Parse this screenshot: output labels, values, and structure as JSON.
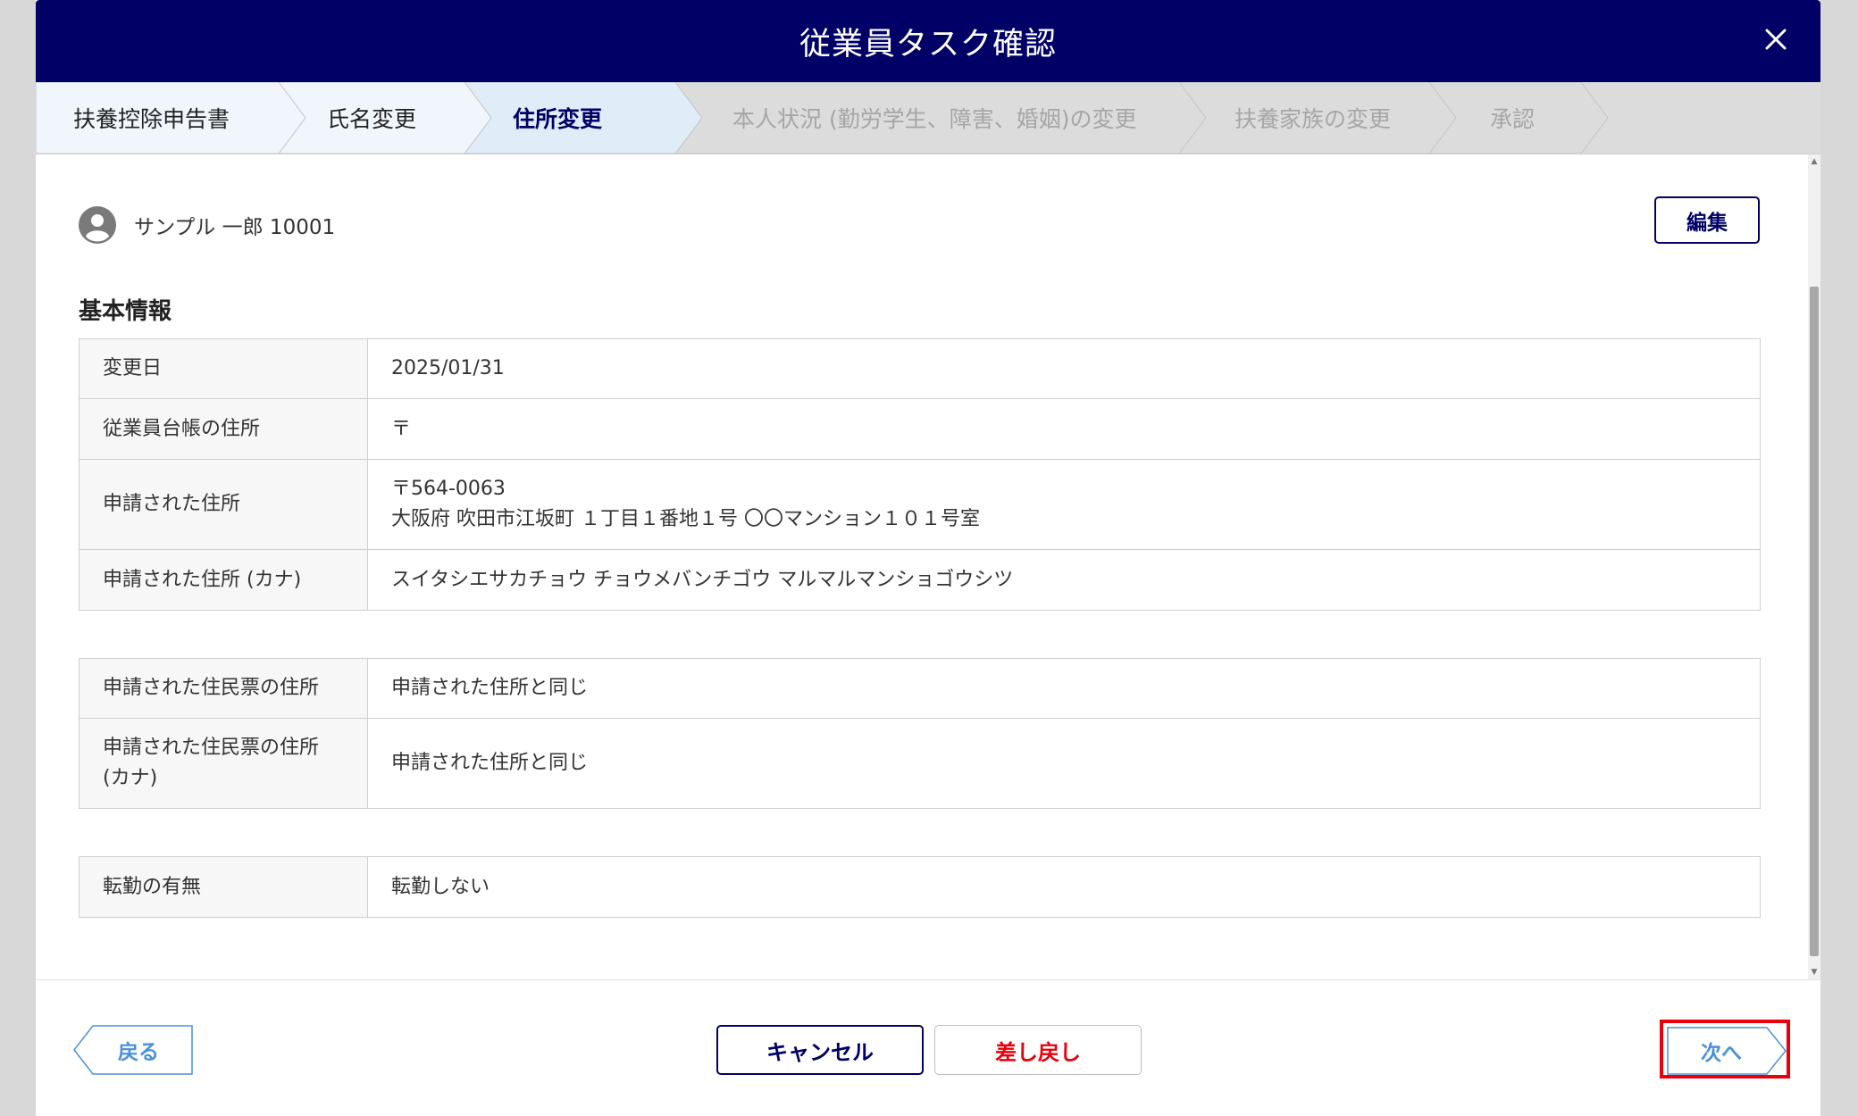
{
  "modal": {
    "title": "従業員タスク確認",
    "close_icon": "close-icon"
  },
  "steps": [
    {
      "label": "扶養控除申告書",
      "state": "done"
    },
    {
      "label": "氏名変更",
      "state": "done"
    },
    {
      "label": "住所変更",
      "state": "active"
    },
    {
      "label": "本人状況 (勤労学生、障害、婚姻)の変更",
      "state": "pending"
    },
    {
      "label": "扶養家族の変更",
      "state": "pending"
    },
    {
      "label": "承認",
      "state": "pending"
    }
  ],
  "employee": {
    "icon": "user-circle-icon",
    "name": "サンプル 一郎 10001"
  },
  "edit_label": "編集",
  "section_title": "基本情報",
  "table1": [
    {
      "key": "変更日",
      "value": "2025/01/31"
    },
    {
      "key": "従業員台帳の住所",
      "value": "〒"
    },
    {
      "key": "申請された住所",
      "value_line1": "〒564-0063",
      "value_line2": "大阪府 吹田市江坂町 １丁目１番地１号 〇〇マンション１０１号室"
    },
    {
      "key": "申請された住所 (カナ)",
      "value": "スイタシエサカチョウ チョウメバンチゴウ マルマルマンショゴウシツ"
    }
  ],
  "table2": [
    {
      "key": "申請された住民票の住所",
      "value": "申請された住所と同じ"
    },
    {
      "key_line1": "申請された住民票の住所",
      "key_line2": "(カナ)",
      "value": "申請された住所と同じ"
    }
  ],
  "table3": [
    {
      "key": "転勤の有無",
      "value": "転勤しない"
    }
  ],
  "footer": {
    "back_label": "戻る",
    "cancel_label": "キャンセル",
    "return_label": "差し戻し",
    "next_label": "次へ"
  },
  "colors": {
    "header_bg": "#000066",
    "accent_navy": "#000066",
    "danger_red": "#e8000b",
    "link_blue": "#4a90d9",
    "step_done_bg": "#f0f6fc",
    "step_active_bg": "#e0ecf8",
    "step_pending_bg": "#dcdcdc"
  }
}
